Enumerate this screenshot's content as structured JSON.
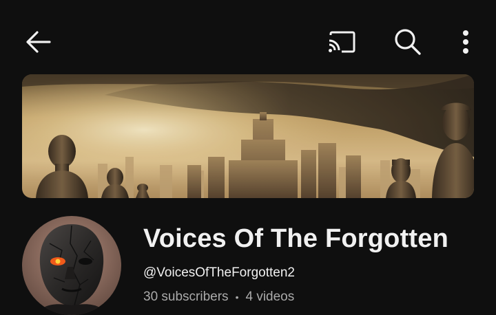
{
  "topbar": {
    "back": {
      "icon": "arrow-left-icon"
    },
    "cast": {
      "icon": "cast-icon"
    },
    "search": {
      "icon": "search-icon"
    },
    "more": {
      "icon": "more-vertical-icon"
    }
  },
  "banner": {
    "description": "channel-banner-image"
  },
  "channel": {
    "name": "Voices Of The Forgotten",
    "handle": "@VoicesOfTheForgotten2",
    "subscribers": "30 subscribers",
    "separator": "•",
    "videos": "4 videos"
  },
  "colors": {
    "background": "#0f0f0f",
    "primary_text": "#f1f1f1",
    "secondary_text": "#aaaaaa"
  }
}
